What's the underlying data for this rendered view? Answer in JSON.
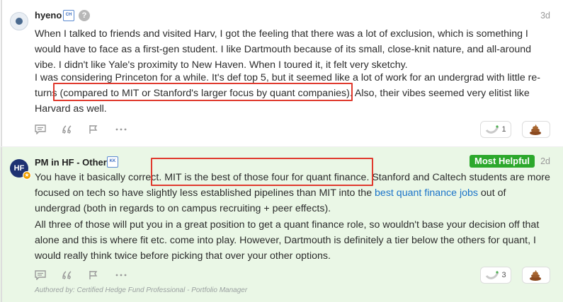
{
  "post1": {
    "author": "hyeno",
    "rank_badge": "CH",
    "help_icon": "?",
    "time": "3d",
    "paragraph1": "When I talked to friends and visited Harv, I got the feeling that there was a lot of exclusion, which is something I would have to face as a first-gen student. I like Dartmouth because of its small, close-knit nature, and all-around vibe. I didn't like Yale's proximity to New Haven. When I toured it, it felt very sketchy.",
    "paragraph2": "I was considering Princeton for a while. It's def top 5, but it seemed like a lot of work for an undergrad with little re-turns (compared to MIT or Stanford's larger focus by quant companies). Also, their vibes seemed very elitist like Harvard as well.",
    "like_count": "1"
  },
  "post2": {
    "author": "PM in HF - Other",
    "avatar_initials": "HF",
    "rank_badge": "KK",
    "badge_label": "Most Helpful",
    "time": "2d",
    "paragraph1_before": "You have it basically correct. MIT is the best of those four for quant finance. Stanford and Caltech students are more focused on tech so have slightly less established pipelines than MIT into the ",
    "paragraph1_link": "best quant finance jobs",
    "paragraph1_after": " out of undergrad (both in regards to on campus recruiting + peer effects).",
    "paragraph2": "All three of those will put you in a great position to get a quant finance role, so wouldn't base your decision off that alone and this is where fit etc. come into play. However, Dartmouth is definitely a tier below the others for quant, I would really think twice before picking that over your other options.",
    "like_count": "3",
    "authored_by": "Authored by: Certified Hedge Fund Professional - Portfolio Manager"
  },
  "colors": {
    "highlight_box": "#e03a2e",
    "most_helpful_bg": "#2ca82c",
    "helpful_post_bg": "#eaf7e6",
    "link": "#1a73c9"
  },
  "icons": [
    "comment-icon",
    "quote-icon",
    "flag-icon",
    "more-icon",
    "like-icon",
    "poop-icon"
  ]
}
